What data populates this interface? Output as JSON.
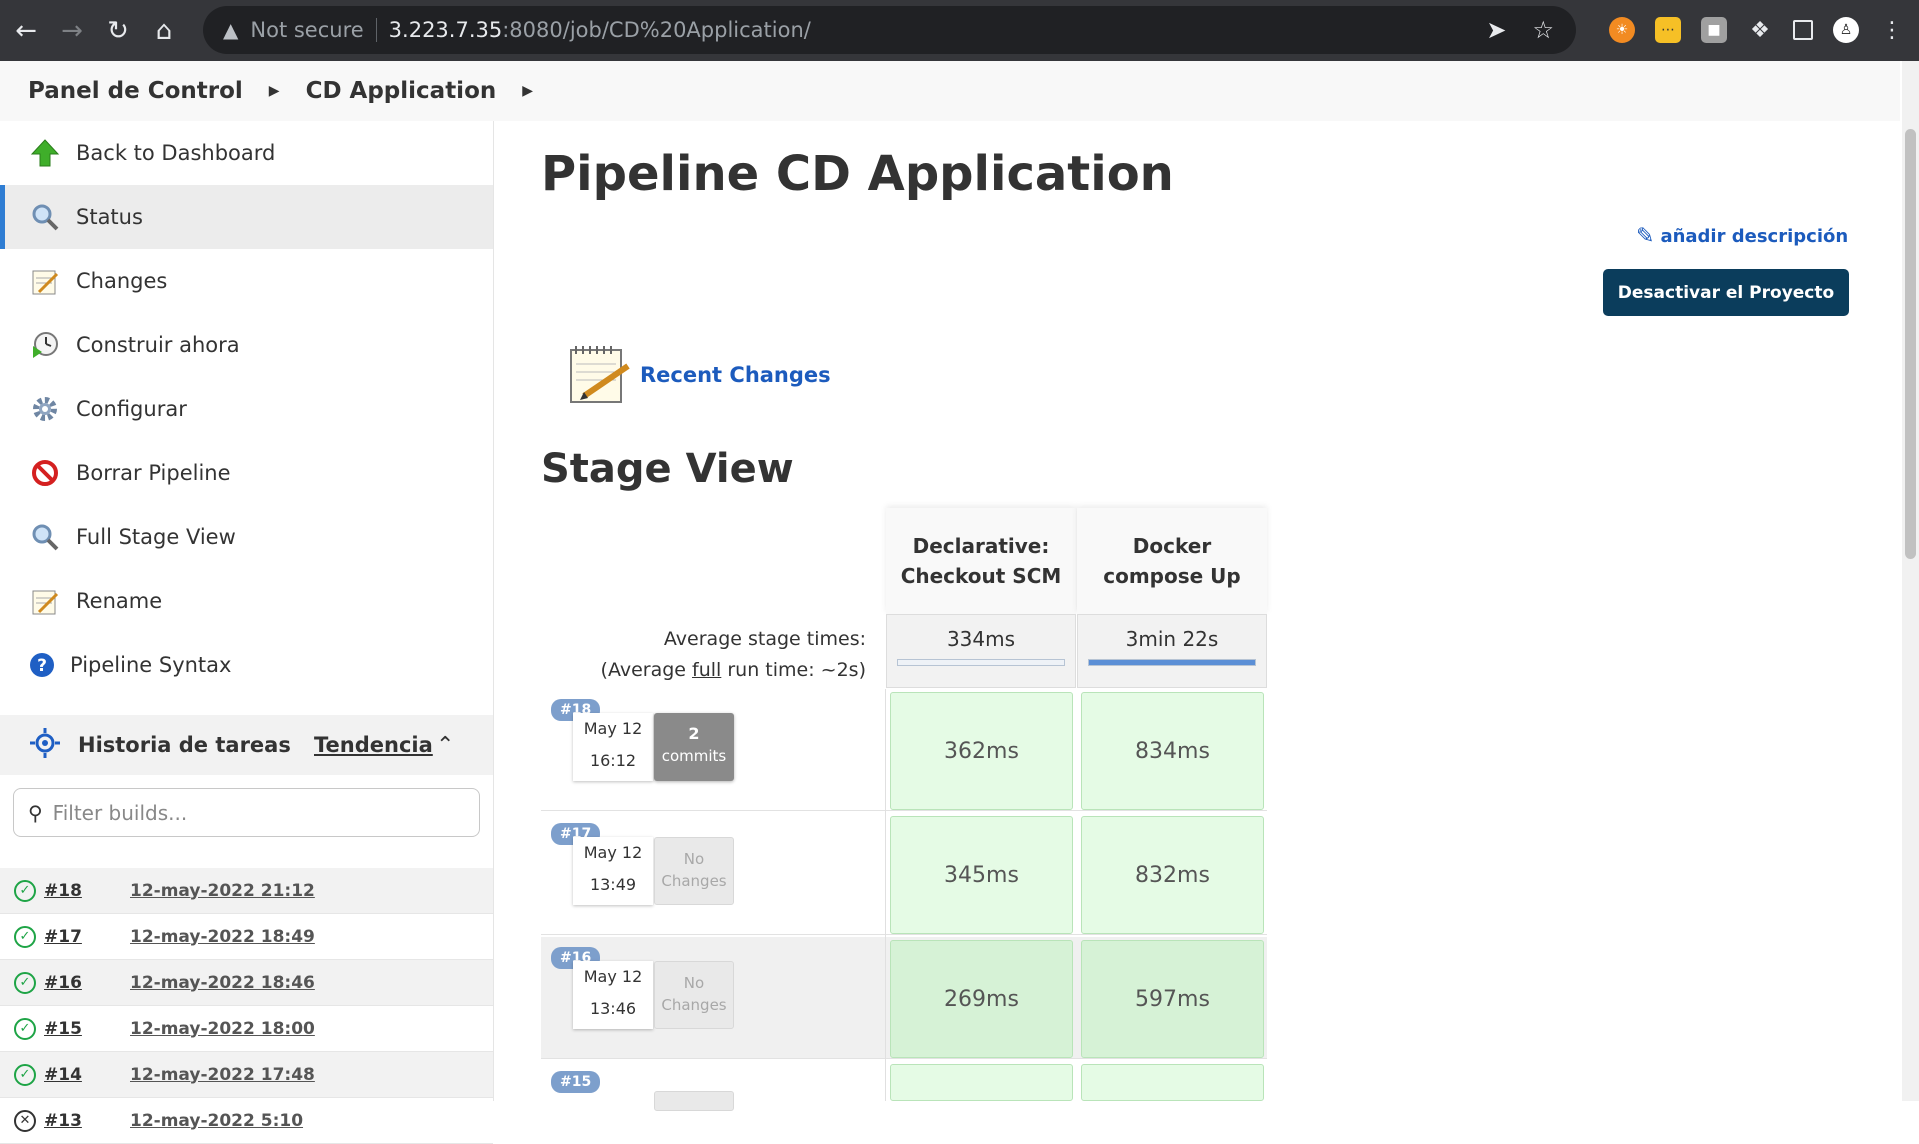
{
  "browser": {
    "security_label": "Not secure",
    "url_host": "3.223.7.35",
    "url_rest": ":8080/job/CD%20Application/"
  },
  "breadcrumb": {
    "items": [
      "Panel de Control",
      "CD Application"
    ]
  },
  "sidebar": {
    "items": [
      {
        "label": "Back to Dashboard",
        "icon": "up-arrow-icon"
      },
      {
        "label": "Status",
        "icon": "search-icon"
      },
      {
        "label": "Changes",
        "icon": "notepad-icon"
      },
      {
        "label": "Construir ahora",
        "icon": "clock-play-icon"
      },
      {
        "label": "Configurar",
        "icon": "gear-icon"
      },
      {
        "label": "Borrar Pipeline",
        "icon": "no-entry-icon"
      },
      {
        "label": "Full Stage View",
        "icon": "search-icon"
      },
      {
        "label": "Rename",
        "icon": "notepad-icon"
      },
      {
        "label": "Pipeline Syntax",
        "icon": "help-icon"
      }
    ],
    "history": {
      "title": "Historia de tareas",
      "trend": "Tendencia",
      "filter_placeholder": "Filter builds...",
      "builds": [
        {
          "num": "#18",
          "date": "12-may-2022 21:12"
        },
        {
          "num": "#17",
          "date": "12-may-2022 18:49"
        },
        {
          "num": "#16",
          "date": "12-may-2022 18:46"
        },
        {
          "num": "#15",
          "date": "12-may-2022 18:00"
        },
        {
          "num": "#14",
          "date": "12-may-2022 17:48"
        },
        {
          "num": "#13",
          "date": "12-may-2022 5:10"
        }
      ]
    }
  },
  "main": {
    "title": "Pipeline CD Application",
    "add_description": "añadir descripción",
    "disable_button": "Desactivar el Proyecto",
    "recent_changes": "Recent Changes",
    "stage_view_title": "Stage View",
    "stages": [
      {
        "name_l1": "Declarative:",
        "name_l2": "Checkout SCM",
        "avg": "334ms",
        "avg_fill": 0.0
      },
      {
        "name_l1": "Docker",
        "name_l2": "compose Up",
        "avg": "3min 22s",
        "avg_fill": 1.0
      }
    ],
    "avg_label_l1": "Average stage times:",
    "avg_label_l2_pre": "(Average ",
    "avg_label_l2_u": "full",
    "avg_label_l2_post": " run time: ~2s)",
    "runs": [
      {
        "badge": "#18",
        "date": "May 12",
        "time": "16:12",
        "commits_n": "2",
        "commits_label": "commits",
        "changes": true,
        "cells": [
          "362ms",
          "834ms"
        ]
      },
      {
        "badge": "#17",
        "date": "May 12",
        "time": "13:49",
        "commits_n": "No",
        "commits_label": "Changes",
        "changes": false,
        "cells": [
          "345ms",
          "832ms"
        ]
      },
      {
        "badge": "#16",
        "date": "May 12",
        "time": "13:46",
        "commits_n": "No",
        "commits_label": "Changes",
        "changes": false,
        "cells": [
          "269ms",
          "597ms"
        ]
      },
      {
        "badge": "#15",
        "date": "",
        "time": "",
        "commits_n": "",
        "commits_label": "",
        "changes": false,
        "cells": [
          "",
          ""
        ]
      }
    ]
  }
}
